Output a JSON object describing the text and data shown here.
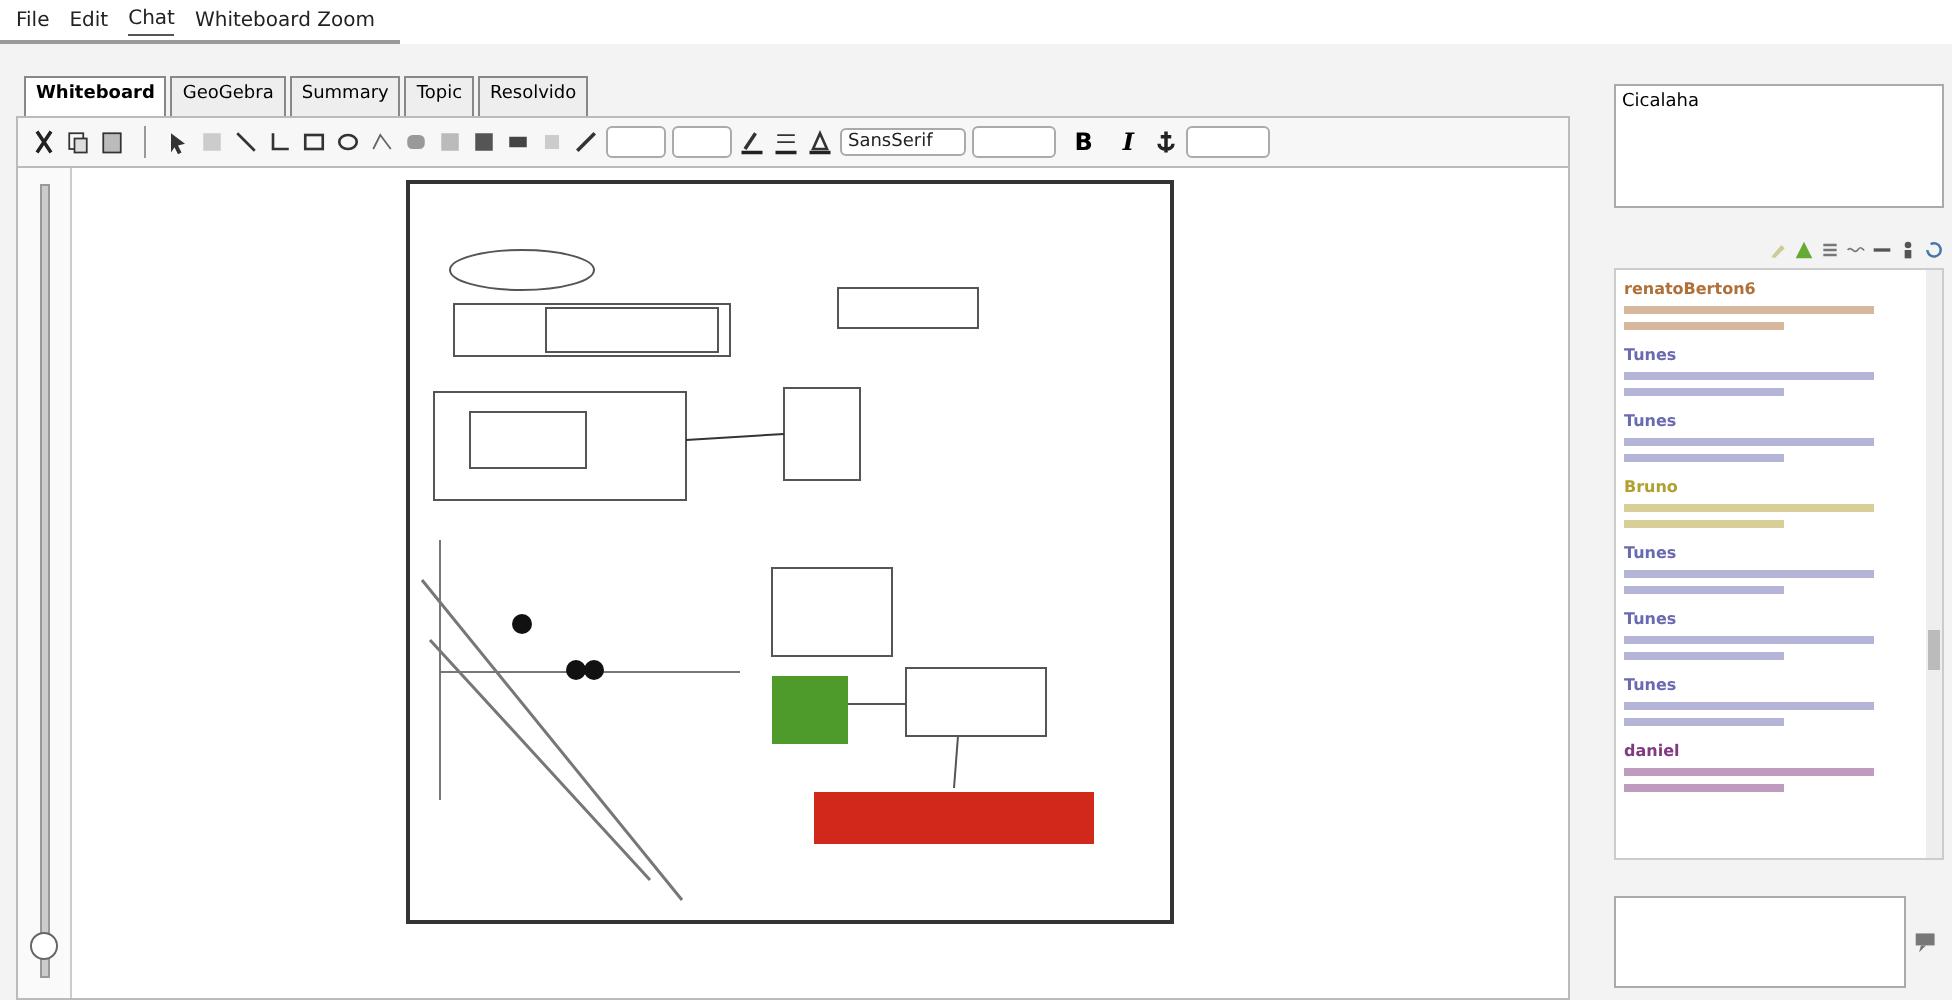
{
  "menu": [
    {
      "label": "File",
      "selected": false
    },
    {
      "label": "Edit",
      "selected": false
    },
    {
      "label": "Chat",
      "selected": true
    },
    {
      "label": "Whiteboard Zoom",
      "selected": false
    }
  ],
  "tabs": [
    {
      "label": "Whiteboard",
      "selected": true
    },
    {
      "label": "GeoGebra",
      "selected": false
    },
    {
      "label": "Summary",
      "selected": false
    },
    {
      "label": "Topic",
      "selected": false
    },
    {
      "label": "Resolvido",
      "selected": false
    }
  ],
  "toolbar": {
    "font": "SansSerif",
    "bold": "B",
    "italic": "I"
  },
  "zoom_slider": {
    "level": 0.02
  },
  "topic_box": {
    "value": "Cicalaha"
  },
  "chat": {
    "messages": [
      {
        "author": "renatoBerton6",
        "color": "#b0703a"
      },
      {
        "author": "Tunes",
        "color": "#6a6ab0"
      },
      {
        "author": "Tunes",
        "color": "#6a6ab0"
      },
      {
        "author": "Bruno",
        "color": "#b0a030"
      },
      {
        "author": "Tunes",
        "color": "#6a6ab0"
      },
      {
        "author": "Tunes",
        "color": "#6a6ab0"
      },
      {
        "author": "Tunes",
        "color": "#6a6ab0"
      },
      {
        "author": "daniel",
        "color": "#803a80"
      }
    ]
  }
}
